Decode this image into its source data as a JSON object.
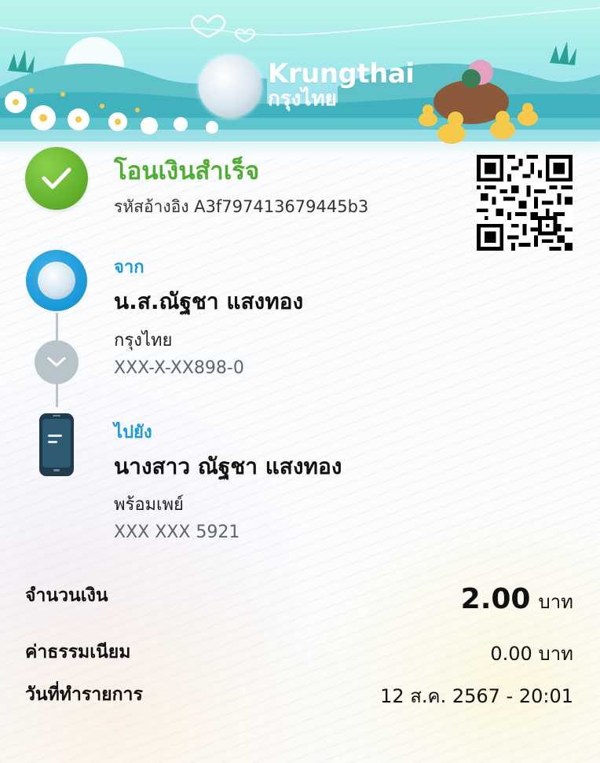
{
  "header": {
    "brand_en": "Krungthai",
    "brand_th": "กรุงไทย"
  },
  "status": {
    "title": "โอนเงินสำเร็จ",
    "reference": "รหัสอ้างอิง A3f797413679445b3",
    "color": "#4fae32"
  },
  "from": {
    "label": "จาก",
    "name": "น.ส.ณัฐชา แสงทอง",
    "bank": "กรุงไทย",
    "account": "XXX-X-XX898-0"
  },
  "to": {
    "label": "ไปยัง",
    "name": "นางสาว ณัฐชา แสงทอง",
    "service": "พร้อมเพย์",
    "account": "XXX XXX 5921"
  },
  "details": {
    "amount_label": "จำนวนเงิน",
    "amount_value": "2.00",
    "amount_unit": "บาท",
    "fee_label": "ค่าธรรมเนียม",
    "fee_value": "0.00 บาท",
    "date_label": "วันที่ทำรายการ",
    "date_value": "12 ส.ค. 2567 - 20:01"
  },
  "colors": {
    "accent_blue": "#1a9ad9",
    "success_green": "#4fae32"
  },
  "icons": [
    "check-icon",
    "krungthai-logo",
    "chevron-down-icon",
    "phone-icon",
    "qr-code"
  ]
}
